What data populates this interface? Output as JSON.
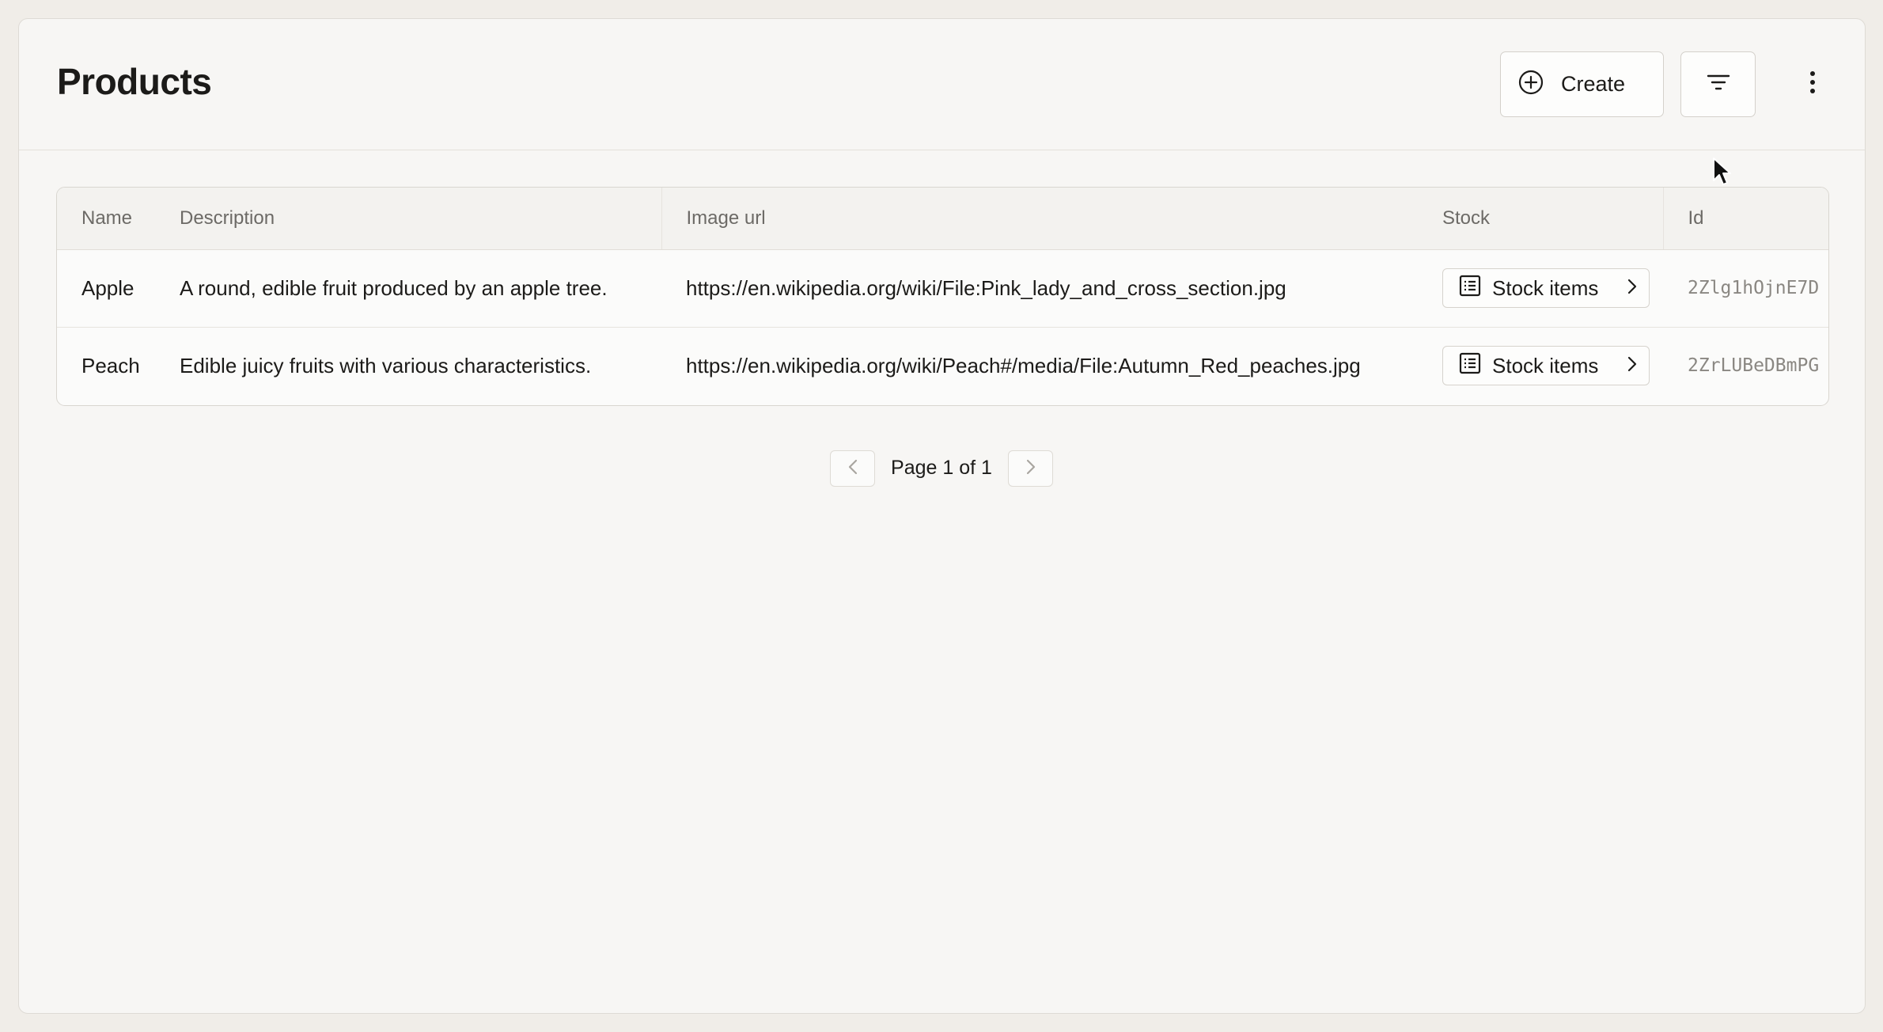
{
  "header": {
    "title": "Products",
    "create_label": "Create",
    "icons": {
      "create": "plus-circle-icon",
      "filter": "filter-icon",
      "more": "more-vertical-icon"
    }
  },
  "table": {
    "columns": [
      "Name",
      "Description",
      "Image url",
      "Stock",
      "Id"
    ],
    "rows": [
      {
        "name": "Apple",
        "description": "A round, edible fruit produced by an apple tree.",
        "image_url": "https://en.wikipedia.org/wiki/File:Pink_lady_and_cross_section.jpg",
        "stock_label": "Stock items",
        "id": "2Zlg1hOjnE7D"
      },
      {
        "name": "Peach",
        "description": "Edible juicy fruits with various characteristics.",
        "image_url": "https://en.wikipedia.org/wiki/Peach#/media/File:Autumn_Red_peaches.jpg",
        "stock_label": "Stock items",
        "id": "2ZrLUBeDBmPG"
      }
    ]
  },
  "pagination": {
    "label": "Page 1 of 1"
  },
  "colors": {
    "background": "#f0ede8",
    "surface": "#f7f6f4",
    "border": "#d4d1cb",
    "text": "#1c1b19",
    "muted": "#6c6a66"
  }
}
